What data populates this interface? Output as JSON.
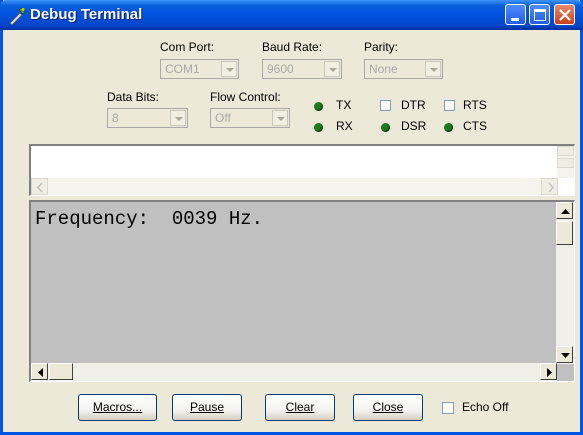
{
  "window": {
    "title": "Debug Terminal",
    "accent": "#0054e3"
  },
  "settings": {
    "com_port": {
      "label": "Com Port:",
      "value": "COM1"
    },
    "baud_rate": {
      "label": "Baud Rate:",
      "value": "9600"
    },
    "parity": {
      "label": "Parity:",
      "value": "None"
    },
    "data_bits": {
      "label": "Data Bits:",
      "value": "8"
    },
    "flow_control": {
      "label": "Flow Control:",
      "value": "Off"
    }
  },
  "indicators": {
    "tx": "TX",
    "rx": "RX",
    "dsr": "DSR",
    "cts": "CTS",
    "led_color": "#1c7a1c"
  },
  "checkboxes": {
    "dtr": {
      "label": "DTR",
      "checked": false
    },
    "rts": {
      "label": "RTS",
      "checked": false
    },
    "echo_off": {
      "label": "Echo Off",
      "checked": false
    }
  },
  "terminal": {
    "output": "Frequency:  0039 Hz.",
    "background": "#c0c0c0"
  },
  "buttons": {
    "macros": "Macros...",
    "pause": "Pause",
    "clear": "Clear",
    "close": "Close"
  }
}
